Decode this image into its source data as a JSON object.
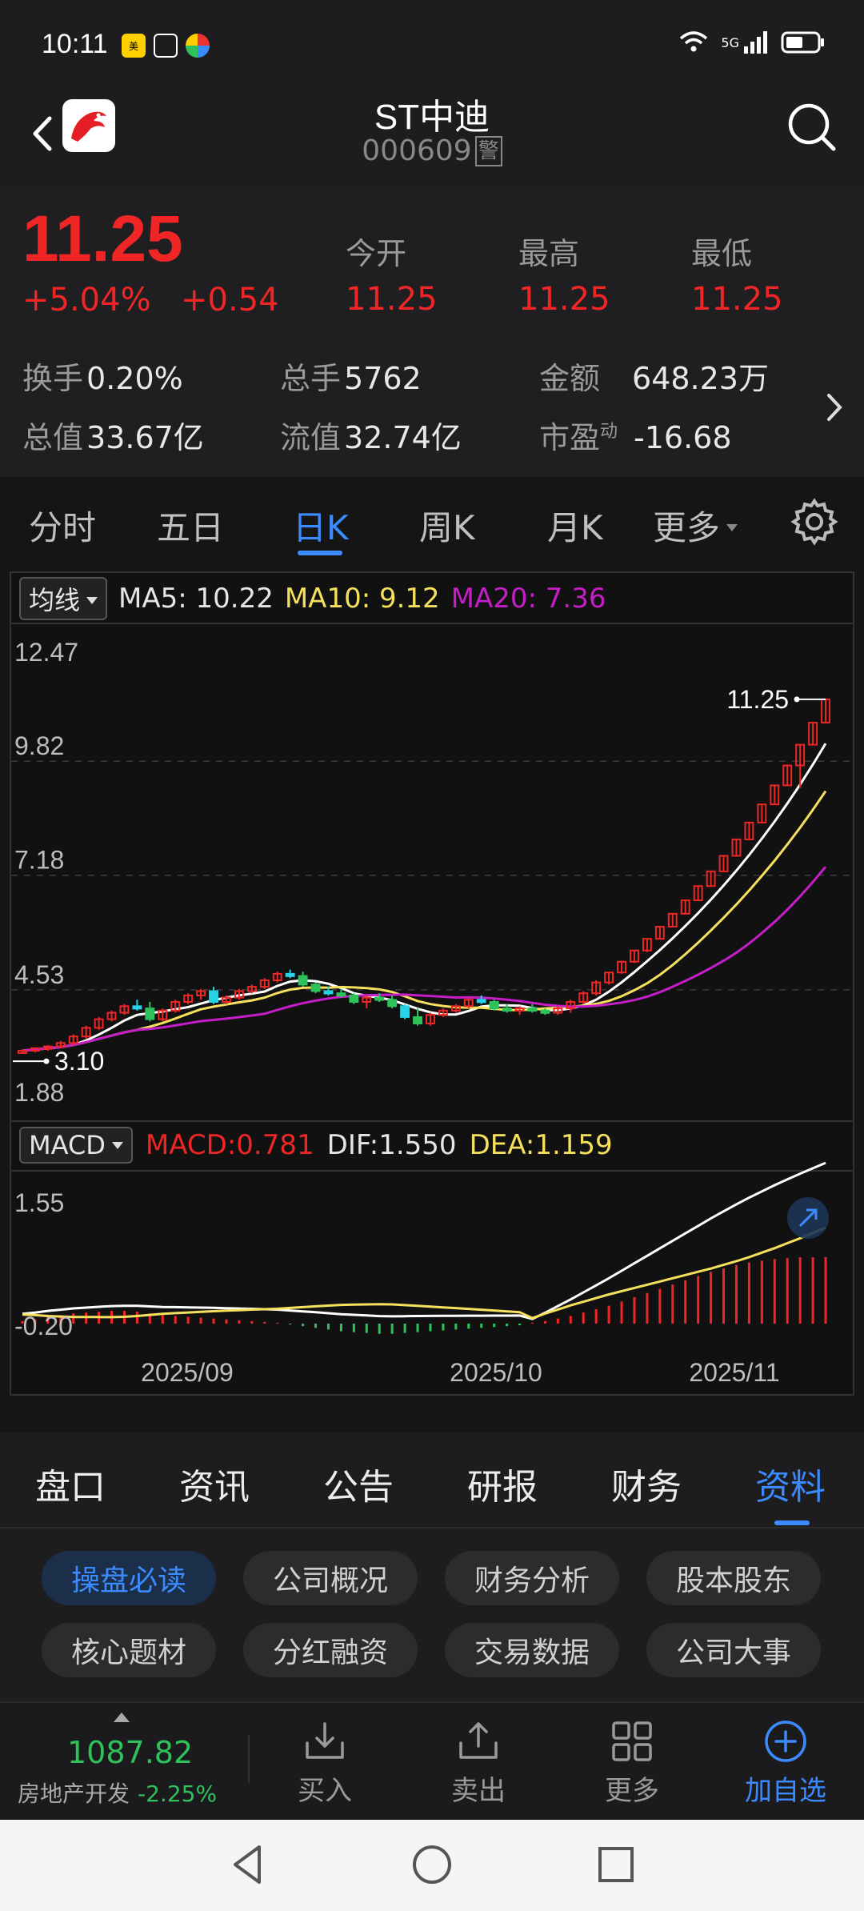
{
  "status_bar": {
    "time": "10:11",
    "network": "5G",
    "app_icons": [
      "meituan-icon",
      "app-icon",
      "browser-icon"
    ]
  },
  "header": {
    "title": "ST中迪",
    "code": "000609",
    "badge": "警"
  },
  "quote": {
    "price": "11.25",
    "change_pct": "+5.04%",
    "change": "+0.54",
    "columns": [
      {
        "label": "今开",
        "value": "11.25"
      },
      {
        "label": "最高",
        "value": "11.25"
      },
      {
        "label": "最低",
        "value": "11.25"
      }
    ],
    "stats": {
      "turnover_label": "换手",
      "turnover": "0.20%",
      "volume_label": "总手",
      "volume": "5762",
      "amount_label": "金额",
      "amount": "648.23万",
      "mktcap_label": "总值",
      "mktcap": "33.67亿",
      "float_label": "流值",
      "float": "32.74亿",
      "pe_label": "市盈",
      "pe_sup": "动",
      "pe": "-16.68"
    }
  },
  "chart_tabs": [
    "分时",
    "五日",
    "日K",
    "周K",
    "月K",
    "更多"
  ],
  "active_chart_tab": "日K",
  "ma_legend": {
    "selector": "均线",
    "ma5": "MA5: 10.22",
    "ma10": "MA10: 9.12",
    "ma20": "MA20: 7.36"
  },
  "macd_legend": {
    "selector": "MACD",
    "macd": "MACD:0.781",
    "dif": "DIF:1.550",
    "dea": "DEA:1.159"
  },
  "colors": {
    "up": "#f02626",
    "down": "#2fc25b",
    "flat_cyan": "#27d3e6",
    "ma5": "#ffffff",
    "ma10": "#f5e15c",
    "ma20": "#c51ec8",
    "accent": "#3b8bff"
  },
  "chart_data": {
    "type": "candlestick",
    "y_ticks": [
      "12.47",
      "9.82",
      "7.18",
      "4.53",
      "1.88"
    ],
    "ylim": [
      1.88,
      12.47
    ],
    "high_marker": "11.25",
    "low_marker": "3.10",
    "x_ticks": [
      "2025/09",
      "2025/10",
      "2025/11"
    ],
    "macd_y_ticks": [
      "1.55",
      "-0.20"
    ],
    "candles": [
      [
        3.1,
        3.15,
        3.05,
        3.12
      ],
      [
        3.12,
        3.2,
        3.08,
        3.18
      ],
      [
        3.18,
        3.25,
        3.12,
        3.22
      ],
      [
        3.22,
        3.35,
        3.18,
        3.3
      ],
      [
        3.3,
        3.5,
        3.25,
        3.45
      ],
      [
        3.45,
        3.7,
        3.4,
        3.65
      ],
      [
        3.65,
        3.9,
        3.6,
        3.85
      ],
      [
        3.85,
        4.05,
        3.8,
        4.0
      ],
      [
        4.0,
        4.2,
        3.95,
        4.15
      ],
      [
        4.15,
        4.3,
        4.05,
        4.1
      ],
      [
        4.1,
        4.25,
        3.8,
        3.85
      ],
      [
        3.85,
        4.1,
        3.8,
        4.05
      ],
      [
        4.05,
        4.3,
        4.0,
        4.25
      ],
      [
        4.25,
        4.45,
        4.2,
        4.4
      ],
      [
        4.4,
        4.55,
        4.3,
        4.5
      ],
      [
        4.5,
        4.6,
        4.2,
        4.25
      ],
      [
        4.25,
        4.4,
        4.2,
        4.35
      ],
      [
        4.35,
        4.55,
        4.3,
        4.5
      ],
      [
        4.5,
        4.65,
        4.45,
        4.6
      ],
      [
        4.6,
        4.8,
        4.55,
        4.75
      ],
      [
        4.75,
        4.95,
        4.7,
        4.9
      ],
      [
        4.9,
        5.0,
        4.8,
        4.85
      ],
      [
        4.85,
        4.95,
        4.6,
        4.65
      ],
      [
        4.65,
        4.7,
        4.45,
        4.5
      ],
      [
        4.5,
        4.6,
        4.4,
        4.45
      ],
      [
        4.45,
        4.55,
        4.35,
        4.4
      ],
      [
        4.4,
        4.45,
        4.2,
        4.25
      ],
      [
        4.25,
        4.4,
        4.1,
        4.35
      ],
      [
        4.35,
        4.45,
        4.25,
        4.3
      ],
      [
        4.3,
        4.4,
        4.1,
        4.15
      ],
      [
        4.15,
        4.2,
        3.85,
        3.9
      ],
      [
        3.9,
        4.1,
        3.7,
        3.75
      ],
      [
        3.75,
        4.0,
        3.7,
        3.95
      ],
      [
        3.95,
        4.1,
        3.9,
        4.05
      ],
      [
        4.05,
        4.2,
        4.0,
        4.15
      ],
      [
        4.15,
        4.35,
        4.1,
        4.3
      ],
      [
        4.3,
        4.4,
        4.2,
        4.25
      ],
      [
        4.25,
        4.3,
        4.05,
        4.1
      ],
      [
        4.1,
        4.2,
        4.0,
        4.05
      ],
      [
        4.05,
        4.15,
        3.95,
        4.1
      ],
      [
        4.1,
        4.2,
        4.0,
        4.05
      ],
      [
        4.05,
        4.1,
        3.95,
        4.0
      ],
      [
        4.0,
        4.15,
        3.95,
        4.1
      ],
      [
        4.1,
        4.3,
        4.0,
        4.25
      ],
      [
        4.25,
        4.5,
        4.2,
        4.45
      ],
      [
        4.45,
        4.75,
        4.4,
        4.7
      ],
      [
        4.7,
        4.95,
        4.65,
        4.93
      ],
      [
        4.93,
        5.2,
        4.9,
        5.18
      ],
      [
        5.18,
        5.45,
        5.15,
        5.44
      ],
      [
        5.44,
        5.72,
        5.4,
        5.71
      ],
      [
        5.71,
        6.0,
        5.7,
        5.99
      ],
      [
        5.99,
        6.3,
        5.98,
        6.29
      ],
      [
        6.29,
        6.61,
        6.28,
        6.6
      ],
      [
        6.6,
        6.94,
        6.59,
        6.93
      ],
      [
        6.93,
        7.28,
        6.92,
        7.27
      ],
      [
        7.27,
        7.64,
        7.26,
        7.63
      ],
      [
        7.63,
        8.02,
        7.62,
        8.01
      ],
      [
        8.01,
        8.41,
        8.0,
        8.4
      ],
      [
        8.4,
        8.83,
        8.39,
        8.82
      ],
      [
        8.82,
        9.27,
        8.81,
        9.26
      ],
      [
        9.26,
        9.73,
        9.25,
        9.72
      ],
      [
        9.72,
        10.21,
        9.2,
        10.2
      ],
      [
        10.2,
        10.72,
        10.19,
        10.71
      ],
      [
        10.71,
        11.25,
        10.7,
        11.25
      ]
    ],
    "macd_hist": [
      0.03,
      0.05,
      0.08,
      0.1,
      0.12,
      0.13,
      0.14,
      0.15,
      0.15,
      0.14,
      0.12,
      0.1,
      0.09,
      0.08,
      0.07,
      0.06,
      0.05,
      0.04,
      0.03,
      0.02,
      0.01,
      -0.01,
      -0.03,
      -0.05,
      -0.07,
      -0.09,
      -0.1,
      -0.11,
      -0.12,
      -0.12,
      -0.11,
      -0.1,
      -0.09,
      -0.08,
      -0.07,
      -0.06,
      -0.05,
      -0.04,
      -0.03,
      -0.02,
      0.01,
      0.03,
      0.06,
      0.09,
      0.13,
      0.17,
      0.21,
      0.26,
      0.31,
      0.36,
      0.41,
      0.46,
      0.51,
      0.56,
      0.61,
      0.65,
      0.69,
      0.72,
      0.74,
      0.76,
      0.77,
      0.78,
      0.78,
      0.781
    ]
  },
  "info_tabs": [
    "盘口",
    "资讯",
    "公告",
    "研报",
    "财务",
    "资料"
  ],
  "active_info_tab": "资料",
  "chips": [
    "操盘必读",
    "公司概况",
    "财务分析",
    "股本股东",
    "核心题材",
    "分红融资",
    "交易数据",
    "公司大事"
  ],
  "active_chip": "操盘必读",
  "toolbar": {
    "index_value": "1087.82",
    "index_name": "房地产开发",
    "index_pct": "-2.25%",
    "buy": "买入",
    "sell": "卖出",
    "more": "更多",
    "watch": "加自选"
  }
}
